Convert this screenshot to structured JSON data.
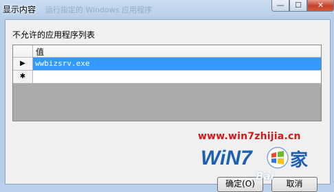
{
  "window": {
    "title": "显示内容",
    "title_ghost": "运行指定的 Windows 应用程序"
  },
  "controls": {
    "minimize_glyph": "—",
    "maximize_glyph": "☐",
    "close_glyph": "✕"
  },
  "dialog": {
    "label": "不允许的应用程序列表"
  },
  "grid": {
    "column_header": "值",
    "rows": [
      {
        "indicator": "▶",
        "value": "wwbizsrv.exe",
        "selected": true
      },
      {
        "indicator": "✱",
        "value": "",
        "selected": false
      }
    ]
  },
  "buttons": {
    "ok": "确定(O)",
    "cancel": "取消"
  },
  "watermark": {
    "url": "www.win7zhijia.cn",
    "logo_text_left": "WiN7",
    "logo_text_right": "家",
    "baidu": "Bai"
  },
  "colors": {
    "selection": "#3399ff",
    "watermark_red": "#d21818",
    "logo_blue": "#1d5fb3"
  }
}
